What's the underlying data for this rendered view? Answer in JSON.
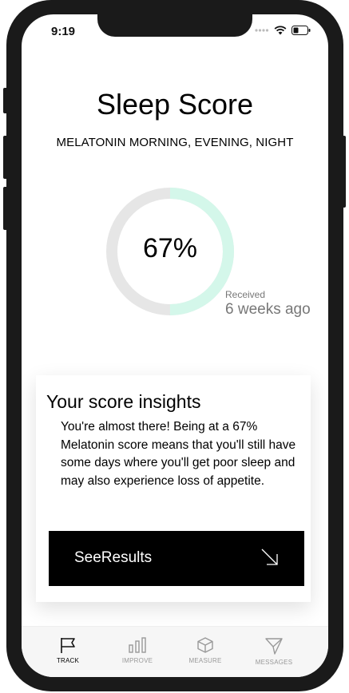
{
  "status_bar": {
    "time": "9:19"
  },
  "header": {
    "title": "Sleep Score",
    "subtitle": "MELATONIN MORNING, EVENING, NIGHT"
  },
  "score": {
    "label": "67%",
    "progress": 0.5,
    "track_color": "#e6e6e6",
    "fill_color": "#d4f7ea"
  },
  "received": {
    "label": "Received",
    "value": "6 weeks ago"
  },
  "insights": {
    "title": "Your score insights",
    "body": "You're almost there! Being at a 67% Melatonin score means that you'll still have some days where you'll get poor sleep and may also experience loss of appetite.",
    "cta_label": "SeeResults"
  },
  "tabbar": {
    "items": [
      {
        "label": "TRACK",
        "icon": "flag-icon",
        "active": true
      },
      {
        "label": "IMPROVE",
        "icon": "bar-chart-icon",
        "active": false
      },
      {
        "label": "MEASURE",
        "icon": "cube-icon",
        "active": false
      },
      {
        "label": "MESSAGES",
        "icon": "send-icon",
        "active": false
      }
    ]
  }
}
